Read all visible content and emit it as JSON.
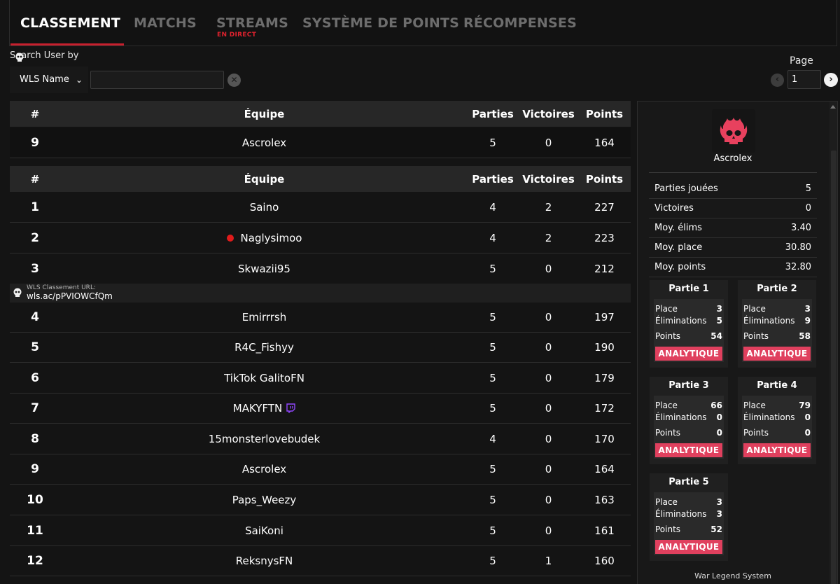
{
  "tabs": [
    {
      "label": "CLASSEMENT"
    },
    {
      "label": "MATCHS"
    },
    {
      "label": "STREAMS"
    },
    {
      "label": "SYSTÈME DE POINTS"
    },
    {
      "label": "RÉCOMPENSES"
    }
  ],
  "live_badge": "EN DIRECT",
  "search": {
    "label": "Search User by",
    "select_value": "WLS Name",
    "input_value": "",
    "clear_icon": "clear-icon"
  },
  "pagination": {
    "label": "Page",
    "value": "1"
  },
  "headers": {
    "rank": "#",
    "team": "Équipe",
    "parties": "Parties",
    "victoires": "Victoires",
    "points": "Points"
  },
  "highlight_row": {
    "rank": "9",
    "team": "Ascrolex",
    "parties": "5",
    "victoires": "0",
    "points": "164"
  },
  "url_banner": {
    "label": "WLS Classement URL:",
    "value": "wls.ac/pPVIOWCfQm"
  },
  "rows": [
    {
      "rank": "1",
      "team": "Saino",
      "parties": "4",
      "victoires": "2",
      "points": "227"
    },
    {
      "rank": "2",
      "team": "Naglysimoo",
      "parties": "4",
      "victoires": "2",
      "points": "223"
    },
    {
      "rank": "3",
      "team": "Skwazii95",
      "parties": "5",
      "victoires": "0",
      "points": "212"
    },
    {
      "rank": "4",
      "team": "Emirrrsh",
      "parties": "5",
      "victoires": "0",
      "points": "197"
    },
    {
      "rank": "5",
      "team": "R4C_Fishyy",
      "parties": "5",
      "victoires": "0",
      "points": "190"
    },
    {
      "rank": "6",
      "team": "TikTok GalitoFN",
      "parties": "5",
      "victoires": "0",
      "points": "179"
    },
    {
      "rank": "7",
      "team": "MAKYFTN",
      "parties": "5",
      "victoires": "0",
      "points": "172"
    },
    {
      "rank": "8",
      "team": "15monsterlovebudek",
      "parties": "4",
      "victoires": "0",
      "points": "170"
    },
    {
      "rank": "9",
      "team": "Ascrolex",
      "parties": "5",
      "victoires": "0",
      "points": "164"
    },
    {
      "rank": "10",
      "team": "Paps_Weezy",
      "parties": "5",
      "victoires": "0",
      "points": "163"
    },
    {
      "rank": "11",
      "team": "SaiKoni",
      "parties": "5",
      "victoires": "0",
      "points": "161"
    },
    {
      "rank": "12",
      "team": "ReksnysFN",
      "parties": "5",
      "victoires": "1",
      "points": "160"
    }
  ],
  "panel": {
    "player": "Ascrolex",
    "stats": [
      {
        "k": "Parties jouées",
        "v": "5"
      },
      {
        "k": "Victoires",
        "v": "0"
      },
      {
        "k": "Moy. élims",
        "v": "3.40"
      },
      {
        "k": "Moy. place",
        "v": "30.80"
      },
      {
        "k": "Moy. points",
        "v": "32.80"
      }
    ],
    "games": [
      {
        "title": "Partie 1",
        "place": "3",
        "elims": "5",
        "points": "54"
      },
      {
        "title": "Partie 2",
        "place": "3",
        "elims": "9",
        "points": "58"
      },
      {
        "title": "Partie 3",
        "place": "66",
        "elims": "0",
        "points": "0"
      },
      {
        "title": "Partie 4",
        "place": "79",
        "elims": "0",
        "points": "0"
      },
      {
        "title": "Partie 5",
        "place": "3",
        "elims": "3",
        "points": "52"
      }
    ],
    "game_labels": {
      "place": "Place",
      "elims": "Éliminations",
      "points": "Points",
      "button": "ANALYTIQUE"
    },
    "footer": "War Legend System"
  },
  "colors": {
    "accent": "#c8202e",
    "button": "#e0405e",
    "live": "#e01b1b",
    "twitch": "#9146ff"
  }
}
